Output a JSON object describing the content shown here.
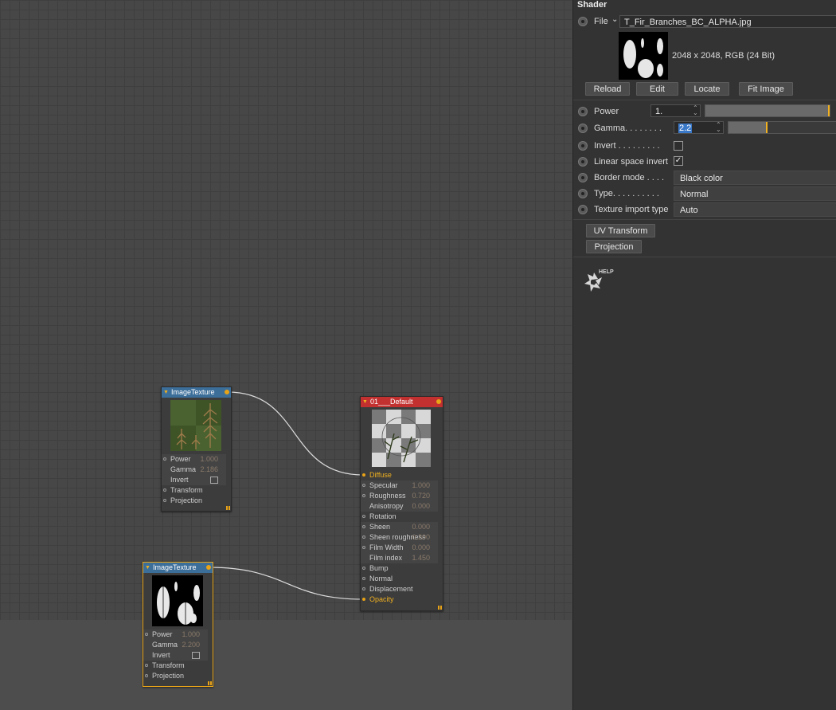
{
  "nodes": {
    "tex1": {
      "title": "ImageTexture",
      "rows": [
        {
          "label": "Power",
          "value": "1.000"
        },
        {
          "label": "Gamma",
          "value": "2.186"
        },
        {
          "label": "Invert"
        },
        {
          "label": "Transform"
        },
        {
          "label": "Projection"
        }
      ]
    },
    "tex2": {
      "title": "ImageTexture",
      "rows": [
        {
          "label": "Power",
          "value": "1.000"
        },
        {
          "label": "Gamma",
          "value": "2.200"
        },
        {
          "label": "Invert"
        },
        {
          "label": "Transform"
        },
        {
          "label": "Projection"
        }
      ]
    },
    "material": {
      "title": "01___Default",
      "rows": [
        {
          "label": "Diffuse"
        },
        {
          "label": "Specular",
          "value": "1.000"
        },
        {
          "label": "Roughness",
          "value": "0.720"
        },
        {
          "label": "Anisotropy",
          "value": "0.000"
        },
        {
          "label": "Rotation"
        },
        {
          "label": "Sheen",
          "value": "0.000"
        },
        {
          "label": "Sheen roughness",
          "value": "0.200"
        },
        {
          "label": "Film Width",
          "value": "0.000"
        },
        {
          "label": "Film index",
          "value": "1.450"
        },
        {
          "label": "Bump"
        },
        {
          "label": "Normal"
        },
        {
          "label": "Displacement"
        },
        {
          "label": "Opacity"
        }
      ]
    }
  },
  "panel": {
    "title": "Shader",
    "file_label": "File",
    "file_value": "T_Fir_Branches_BC_ALPHA.jpg",
    "image_info": "2048 x 2048, RGB (24 Bit)",
    "buttons": {
      "reload": "Reload",
      "edit": "Edit",
      "locate": "Locate",
      "fit": "Fit Image"
    },
    "power_label": "Power",
    "power_value": "1.",
    "gamma_label": "Gamma. . . . . . . .",
    "gamma_value": "2.2",
    "invert_label": "Invert . . . . . . . . .",
    "linear_label": "Linear space invert",
    "border_label": "Border mode . . . .",
    "border_value": "Black color",
    "type_label": "Type. . . . . . . . . .",
    "type_value": "Normal",
    "import_label": "Texture import type",
    "import_value": "Auto",
    "uv_button": "UV Transform",
    "projection_button": "Projection",
    "help_label": "HELP",
    "power_level": 0.99,
    "gamma_level": 0.35
  },
  "colors": {
    "accent": "#e8a317",
    "material_header": "#c23030",
    "texture_header": "#3c6e9a"
  }
}
